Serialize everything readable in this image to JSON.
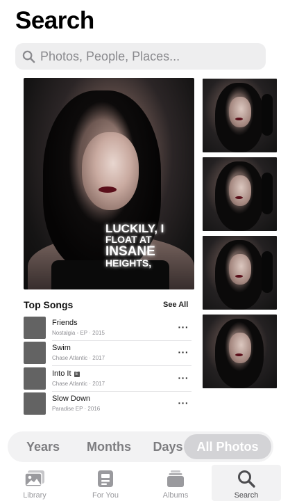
{
  "header": {
    "title": "Search"
  },
  "search": {
    "placeholder": "Photos, People, Places..."
  },
  "hero": {
    "lyrics": [
      "LUCKILY, I",
      "FLOAT AT",
      "INSANE",
      "HEIGHTS,"
    ]
  },
  "top_songs": {
    "title": "Top Songs",
    "see_all": "See All",
    "songs": [
      {
        "name": "Friends",
        "meta": "Nostalgia - EP · 2015",
        "explicit": false
      },
      {
        "name": "Swim",
        "meta": "Chase Atlantic · 2017",
        "explicit": false
      },
      {
        "name": "Into It",
        "meta": "Chase Atlantic · 2017",
        "explicit": true,
        "explicit_badge": "E"
      },
      {
        "name": "Slow Down",
        "meta": "Paradise EP · 2016",
        "explicit": false
      }
    ],
    "more_glyph": "···"
  },
  "segments": {
    "items": [
      "Years",
      "Months",
      "Days",
      "All Photos"
    ],
    "selected": "All Photos"
  },
  "tabbar": {
    "items": [
      {
        "label": "Library",
        "icon": "photo-library-icon"
      },
      {
        "label": "For You",
        "icon": "for-you-icon"
      },
      {
        "label": "Albums",
        "icon": "albums-stack-icon"
      },
      {
        "label": "Search",
        "icon": "search-icon"
      }
    ],
    "selected": "Search"
  },
  "colors": {
    "background": "#ffffff",
    "search_bar": "#eeeeef",
    "placeholder": "#8a8a8e",
    "segment_active": "#d3d3d6",
    "tab_inactive": "#9a9a9e",
    "lips_accent": "#5a0f1a"
  }
}
